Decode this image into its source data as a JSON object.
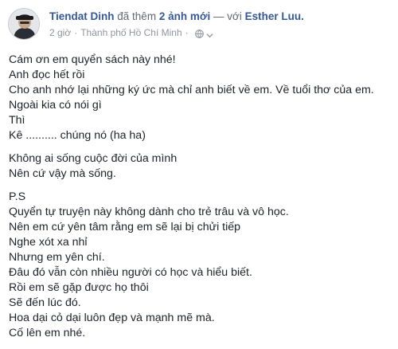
{
  "post": {
    "author": "Tiendat Dinh",
    "verb": "đã thêm",
    "photos": "2 ảnh mới",
    "with_word": "— với",
    "tagged": "Esther Luu.",
    "time": "2 giờ",
    "separator": "·",
    "location": "Thành phố Hồ Chí Minh",
    "privacy_icon": "globe-icon",
    "menu_icon": "chevron-down-icon"
  },
  "content": {
    "p1": [
      "Cám ơn em quyển sách này nhé!",
      "Anh đọc hết rồi",
      "Cho anh nhớ lại những ký ức mà chỉ anh biết về em. Về tuổi thơ của em.",
      "Ngoài kia có nói gì",
      "Thì",
      "Kê .......... chúng nó (ha ha)"
    ],
    "p2": [
      "Không ai sống cuộc đời của mình",
      "Nên cứ vậy mà sống."
    ],
    "p3": [
      "P.S",
      "Quyển tự truyện này không dành cho trẻ trâu và vô học.",
      "Nên em cứ yên tâm rằng em sẽ lại bị chửi tiếp",
      "Nghe xót xa nhỉ",
      "Nhưng em yên chí.",
      "Đâu đó vẫn còn nhiều người có học và hiểu biết.",
      "Rồi em sẽ gặp được họ thôi",
      "Sẽ đến lúc đó.",
      "Hoa dại cỏ dại luôn đẹp và mạnh mẽ mà.",
      "Cố lên em nhé."
    ]
  },
  "colors": {
    "link": "#365899",
    "meta": "#90949c",
    "text": "#1d2129"
  }
}
